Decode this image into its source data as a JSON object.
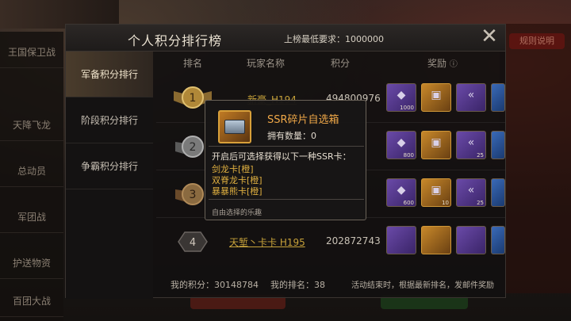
{
  "background": {
    "left_items": [
      "王国保卫战",
      "天降飞龙",
      "总动员",
      "军团战",
      "护送物资",
      "百团大战"
    ],
    "right_button": "规则说明"
  },
  "panel": {
    "title": "个人积分排行榜",
    "min_requirement": "上榜最低要求：1000000",
    "close_icon": "close-icon"
  },
  "tabs": [
    {
      "label": "军备积分排行",
      "active": true
    },
    {
      "label": "阶段积分排行",
      "active": false
    },
    {
      "label": "争霸积分排行",
      "active": false
    }
  ],
  "table": {
    "headers": [
      "排名",
      "玩家名称",
      "积分",
      "奖励"
    ],
    "rows": [
      {
        "rank": "1",
        "name": "新豪_H194",
        "score": "494800976",
        "rewards": [
          "1000",
          "",
          "",
          ""
        ]
      },
      {
        "rank": "2",
        "name": "",
        "score": "",
        "rewards": [
          "800",
          "",
          "25",
          ""
        ]
      },
      {
        "rank": "3",
        "name": "",
        "score": "",
        "rewards": [
          "600",
          "10",
          "25",
          ""
        ]
      },
      {
        "rank": "4",
        "name": "天堑丶卡卡 H195",
        "score": "202872743",
        "rewards": [
          "",
          "",
          "",
          ""
        ]
      }
    ]
  },
  "footer": {
    "my_score": "我的积分：30148784",
    "my_rank": "我的排名：38",
    "note": "活动结束时，根据最新排名，发邮件奖励"
  },
  "popup": {
    "title": "SSR碎片自选箱",
    "owned": "拥有数量：0",
    "description": "开启后可选择获得以下一种SSR卡：",
    "options": [
      "剑龙卡[橙]",
      "双脊龙卡[橙]",
      "暴暴熊卡[橙]"
    ],
    "note": "自由选择的乐趣"
  },
  "colors": {
    "accent_orange": "#f0a848",
    "option_gold": "#e0b040",
    "name_gold": "#c7a23a"
  }
}
